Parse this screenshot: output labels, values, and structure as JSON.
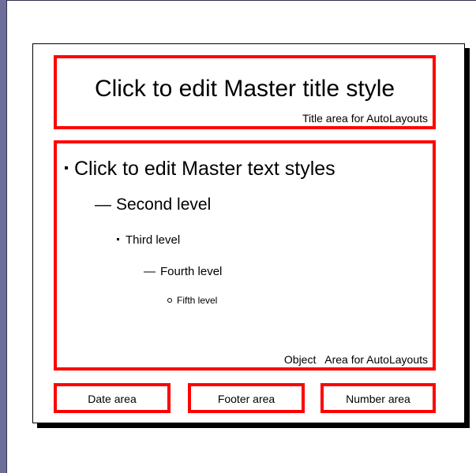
{
  "slide": {
    "title": "Click to edit Master title style",
    "title_caption": "Title area for AutoLayouts",
    "levels": [
      {
        "marker": "",
        "text": "Click to edit Master text styles"
      },
      {
        "marker": "—",
        "text": "Second level"
      },
      {
        "marker": "",
        "text": "Third level"
      },
      {
        "marker": "—",
        "text": "Fourth level"
      },
      {
        "marker": "",
        "text": "Fifth level"
      }
    ],
    "body_caption": "Object   Area for AutoLayouts",
    "date_label": "Date area",
    "footer_label": "Footer area",
    "number_label": "Number area"
  },
  "colors": {
    "placeholder_border": "#ff0000",
    "background": "#6e6e9a"
  }
}
